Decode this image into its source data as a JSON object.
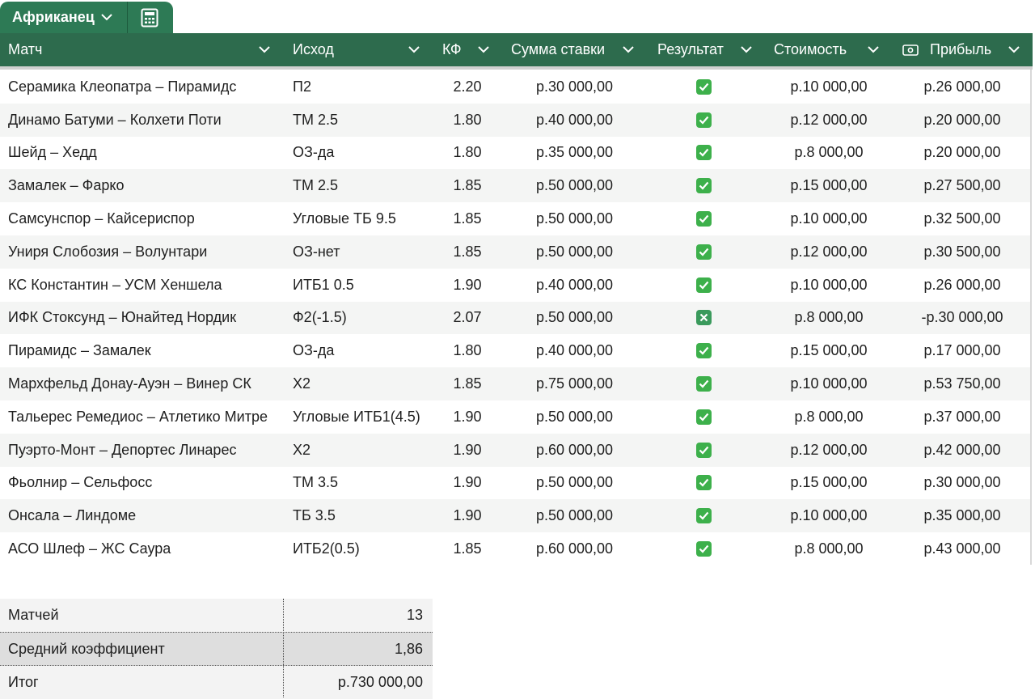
{
  "tab": {
    "name": "Африканец"
  },
  "columns": [
    "Матч",
    "Исход",
    "КФ",
    "Сумма ставки",
    "Результат",
    "Стоимость",
    "Прибыль"
  ],
  "rows": [
    {
      "match": "Серамика Клеопатра – Пирамидс",
      "outcome": "П2",
      "kf": "2.20",
      "stake": "р.30 000,00",
      "result": "win",
      "cost": "р.10 000,00",
      "profit": "р.26 000,00"
    },
    {
      "match": "Динамо Батуми – Колхети Поти",
      "outcome": "ТМ 2.5",
      "kf": "1.80",
      "stake": "р.40 000,00",
      "result": "win",
      "cost": "р.12 000,00",
      "profit": "р.20 000,00"
    },
    {
      "match": "Шейд – Хедд",
      "outcome": "ОЗ-да",
      "kf": "1.80",
      "stake": "р.35 000,00",
      "result": "win",
      "cost": "р.8 000,00",
      "profit": "р.20 000,00"
    },
    {
      "match": "Замалек – Фарко",
      "outcome": "ТМ 2.5",
      "kf": "1.85",
      "stake": "р.50 000,00",
      "result": "win",
      "cost": "р.15 000,00",
      "profit": "р.27 500,00"
    },
    {
      "match": "Самсунспор – Кайсериспор",
      "outcome": "Угловые ТБ 9.5",
      "kf": "1.85",
      "stake": "р.50 000,00",
      "result": "win",
      "cost": "р.10 000,00",
      "profit": "р.32 500,00"
    },
    {
      "match": "Униря Слобозия – Волунтари",
      "outcome": "ОЗ-нет",
      "kf": "1.85",
      "stake": "р.50 000,00",
      "result": "win",
      "cost": "р.12 000,00",
      "profit": "р.30 500,00"
    },
    {
      "match": "КС Константин – УСМ Хеншела",
      "outcome": "ИТБ1 0.5",
      "kf": "1.90",
      "stake": "р.40 000,00",
      "result": "win",
      "cost": "р.10 000,00",
      "profit": "р.26 000,00"
    },
    {
      "match": "ИФК Стоксунд – Юнайтед Нордик",
      "outcome": "Ф2(-1.5)",
      "kf": "2.07",
      "stake": "р.50 000,00",
      "result": "loss",
      "cost": "р.8 000,00",
      "profit": "-р.30 000,00"
    },
    {
      "match": "Пирамидс – Замалек",
      "outcome": "ОЗ-да",
      "kf": "1.80",
      "stake": "р.40 000,00",
      "result": "win",
      "cost": "р.15 000,00",
      "profit": "р.17 000,00"
    },
    {
      "match": "Мархфельд Донау-Ауэн – Винер СК",
      "outcome": "Х2",
      "kf": "1.85",
      "stake": "р.75 000,00",
      "result": "win",
      "cost": "р.10 000,00",
      "profit": "р.53 750,00"
    },
    {
      "match": "Тальерес Ремедиос – Атлетико Митре",
      "outcome": "Угловые ИТБ1(4.5)",
      "kf": "1.90",
      "stake": "р.50 000,00",
      "result": "win",
      "cost": "р.8 000,00",
      "profit": "р.37 000,00"
    },
    {
      "match": "Пуэрто-Монт – Депортес Линарес",
      "outcome": "Х2",
      "kf": "1.90",
      "stake": "р.60 000,00",
      "result": "win",
      "cost": "р.12 000,00",
      "profit": "р.42 000,00"
    },
    {
      "match": "Фьолнир – Сельфосс",
      "outcome": "ТМ 3.5",
      "kf": "1.90",
      "stake": "р.50 000,00",
      "result": "win",
      "cost": "р.15 000,00",
      "profit": "р.30 000,00"
    },
    {
      "match": "Онсала – Линдоме",
      "outcome": "ТБ 3.5",
      "kf": "1.90",
      "stake": "р.50 000,00",
      "result": "win",
      "cost": "р.10 000,00",
      "profit": "р.35 000,00"
    },
    {
      "match": "АСО Шлеф – ЖС Саура",
      "outcome": "ИТБ2(0.5)",
      "kf": "1.85",
      "stake": "р.60 000,00",
      "result": "win",
      "cost": "р.8 000,00",
      "profit": "р.43 000,00"
    }
  ],
  "summary": [
    {
      "label": "Матчей",
      "value": "13"
    },
    {
      "label": "Средний коэффициент",
      "value": "1,86"
    },
    {
      "label": "Итог",
      "value": "р.730 000,00"
    }
  ],
  "colors": {
    "header_bg": "#2d6b4d",
    "tab_bg": "#2d7a55",
    "check_green": "#3db04b"
  },
  "icons": {
    "tab_dropdown": "chevron-down-icon",
    "calc": "calculator-icon",
    "profit_header": "money-icon",
    "win": "check-icon",
    "loss": "cross-icon"
  }
}
